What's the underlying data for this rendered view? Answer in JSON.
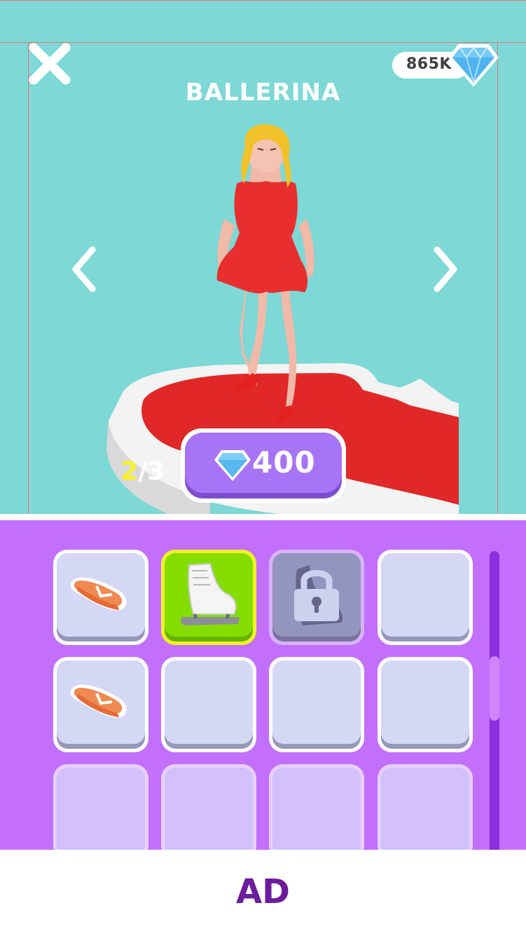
{
  "header": {
    "currency": "865K",
    "title": "BALLERINA"
  },
  "navigation": {
    "prev": "chevron-left-icon",
    "next": "chevron-right-icon"
  },
  "pager": {
    "current": "2",
    "total": "/3"
  },
  "purchase": {
    "price": "400"
  },
  "inventory": {
    "scroll_position": 0.35,
    "slots": [
      {
        "item": "flip-flop",
        "state": "available"
      },
      {
        "item": "ice-skate",
        "state": "selected"
      },
      {
        "item": "boot",
        "state": "locked"
      },
      {
        "item": "",
        "state": "empty"
      },
      {
        "item": "flip-flop",
        "state": "available"
      },
      {
        "item": "",
        "state": "empty"
      },
      {
        "item": "",
        "state": "empty"
      },
      {
        "item": "",
        "state": "empty"
      },
      {
        "item": "",
        "state": "empty"
      },
      {
        "item": "",
        "state": "empty"
      },
      {
        "item": "",
        "state": "empty"
      },
      {
        "item": "",
        "state": "empty"
      }
    ]
  },
  "ad": {
    "label": "AD"
  },
  "colors": {
    "background": "#7dd8d6",
    "panel": "#c270fc",
    "button": "#a774f6",
    "selected": "#85dd00",
    "highlight": "#f7f22a",
    "ad_text": "#6b1c9b",
    "platform_red": "#e02828"
  }
}
